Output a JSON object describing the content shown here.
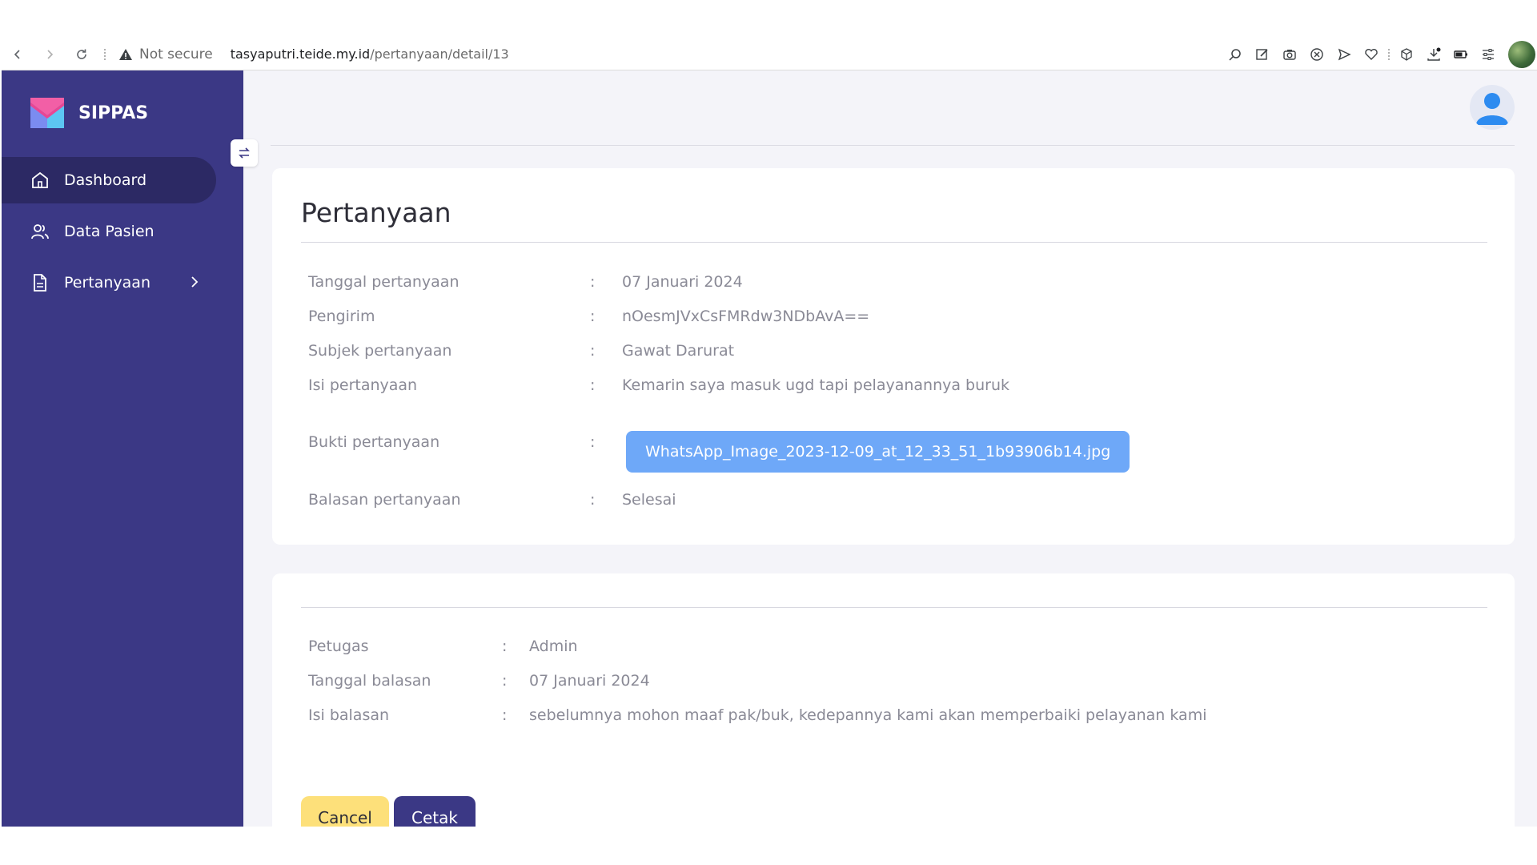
{
  "browser": {
    "security_label": "Not secure",
    "url_host": "tasyaputri.teide.my.id",
    "url_path": "/pertanyaan/detail/13"
  },
  "sidebar": {
    "brand": "SIPPAS",
    "items": [
      {
        "label": "Dashboard",
        "icon": "home-icon",
        "active": true
      },
      {
        "label": "Data Pasien",
        "icon": "users-icon",
        "active": false
      },
      {
        "label": "Pertanyaan",
        "icon": "file-icon",
        "active": false
      }
    ]
  },
  "question": {
    "title": "Pertanyaan",
    "separator": ":",
    "fields": [
      {
        "label": "Tanggal pertanyaan",
        "value": "07 Januari 2024"
      },
      {
        "label": "Pengirim",
        "value": "nOesmJVxCsFMRdw3NDbAvA=="
      },
      {
        "label": "Subjek pertanyaan",
        "value": "Gawat Darurat"
      },
      {
        "label": "Isi pertanyaan",
        "value": "Kemarin saya masuk ugd tapi pelayanannya buruk"
      }
    ],
    "attachment_label": "Bukti pertanyaan",
    "attachment_file": "WhatsApp_Image_2023-12-09_at_12_33_51_1b93906b14.jpg",
    "reply_status_label": "Balasan pertanyaan",
    "reply_status": "Selesai"
  },
  "reply": {
    "fields": [
      {
        "label": "Petugas",
        "value": "Admin"
      },
      {
        "label": "Tanggal balasan",
        "value": "07 Januari 2024"
      },
      {
        "label": "Isi balasan",
        "value": "sebelumnya mohon maaf pak/buk, kedepannya kami akan memperbaiki pelayanan kami"
      }
    ],
    "cancel_label": "Cancel",
    "print_label": "Cetak"
  },
  "colors": {
    "sidebar": "#3b3885",
    "sidebar_active": "#2c2964",
    "attachment_button": "#6ea8f8",
    "cancel_button": "#fde07a",
    "print_button": "#3b3885",
    "status_done": "#2f8a2f"
  }
}
